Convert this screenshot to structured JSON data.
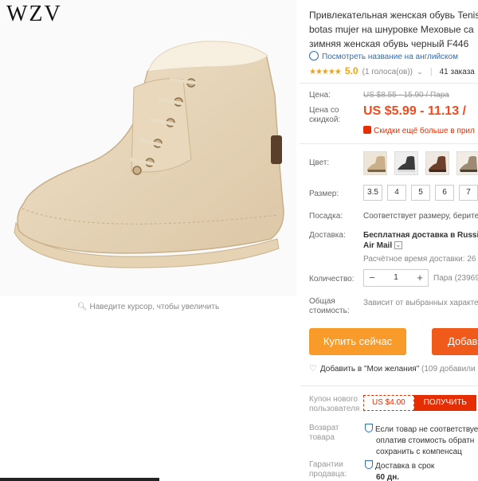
{
  "brand": "WZV",
  "zoom_hint": "Наведите курсор, чтобы увеличить",
  "product": {
    "title_line1": "Привлекательная женская обувь Tenis",
    "title_line2": "botas mujer на шнуровке Меховые са",
    "title_line3": "зимняя женская обувь черный F446",
    "translate_link": "Посмотреть название на английском",
    "rating_stars": "★★★★★",
    "rating_value": "5.0",
    "rating_votes": "(1 голоса(ов))",
    "orders": "41 заказа"
  },
  "price": {
    "price_label": "Цена:",
    "old_price": "US $8.55 - 15.90 / Пара",
    "discount_label_1": "Цена со",
    "discount_label_2": "скидкой:",
    "new_price": "US $5.99 - 11.13 /",
    "discount_note": "Скидки ещё больше в прил"
  },
  "options": {
    "color_label": "Цвет:",
    "size_label": "Размер:",
    "sizes": [
      "3.5",
      "4",
      "5",
      "6",
      "7"
    ],
    "fit_label": "Посадка:",
    "fit_value": "Соответствует размеру, берите"
  },
  "shipping": {
    "label": "Доставка:",
    "line1": "Бесплатная доставка в Russi",
    "line2": "Air Mail",
    "eta": "Расчётное время доставки: 26"
  },
  "quantity": {
    "label": "Количество:",
    "value": "1",
    "minus": "−",
    "plus": "+",
    "available": "Пара (23969"
  },
  "total": {
    "label_1": "Общая",
    "label_2": "стоимость:",
    "value": "Зависит от выбранных характе"
  },
  "actions": {
    "buy_now": "Купить сейчас",
    "add_to_cart": "Добав",
    "wishlist": "Добавить в \"Мои желания\"",
    "wishlist_count": "(109 добавили"
  },
  "coupon": {
    "label_1": "Купон нового",
    "label_2": "пользователя",
    "amount": "US $4.00",
    "get": "ПОЛУЧИТЬ"
  },
  "returns": {
    "label_1": "Возврат",
    "label_2": "товара",
    "line1": "Если товар не соответствует",
    "line2": "оплатив стоимость обратн",
    "line3": "сохранить с компенсац"
  },
  "guarantee": {
    "label_1": "Гарантии",
    "label_2": "продавца:",
    "line1": "Доставка в срок",
    "line2": "60 дн."
  },
  "colors": {
    "accent_orange": "#f89b2a",
    "accent_red": "#f05a1a",
    "price_red": "#f04b1e",
    "link_blue": "#2e6db4"
  }
}
